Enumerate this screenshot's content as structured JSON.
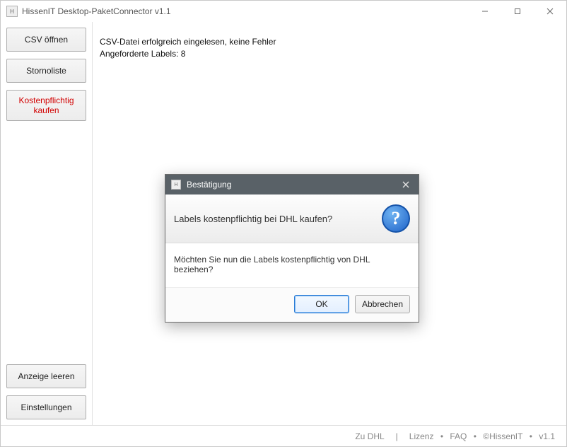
{
  "window": {
    "title": "HissenIT Desktop-PaketConnector v1.1",
    "icon_letter": "H"
  },
  "sidebar": {
    "csv_open": "CSV öffnen",
    "storno": "Stornoliste",
    "buy": "Kostenpflichtig\nkaufen",
    "clear": "Anzeige leeren",
    "settings": "Einstellungen"
  },
  "main": {
    "status_line1": "CSV-Datei erfolgreich eingelesen, keine Fehler",
    "status_line2": "Angeforderte Labels: 8"
  },
  "footer": {
    "zu_dhl": "Zu DHL",
    "sep1": "   |   ",
    "lizenz": "Lizenz",
    "dot1": " • ",
    "faq": "FAQ",
    "dot2": " • ",
    "copyright": "©HissenIT",
    "dot3": " • ",
    "version": "v1.1"
  },
  "dialog": {
    "title": "Bestätigung",
    "icon_letter": "H",
    "headline": "Labels kostenpflichtig bei DHL kaufen?",
    "question_mark": "?",
    "body": "Möchten Sie nun die Labels kostenpflichtig von DHL beziehen?",
    "ok": "OK",
    "cancel": "Abbrechen"
  }
}
